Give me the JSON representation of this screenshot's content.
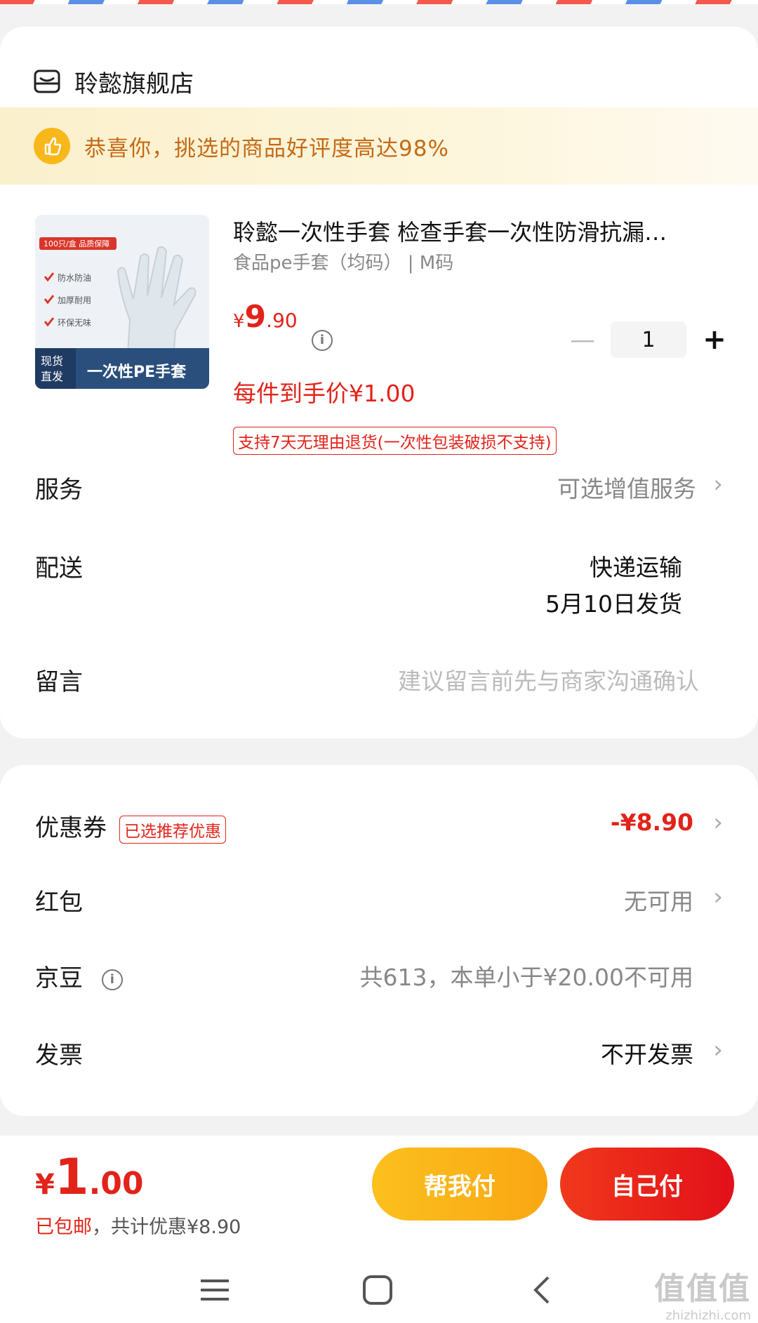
{
  "shop": {
    "name": "聆懿旗舰店"
  },
  "banner": {
    "text": "恭喜你，挑选的商品好评度高达98%"
  },
  "product": {
    "image_overlay": {
      "top_tag": "100只/盒 品质保障",
      "features": [
        "防水防油",
        "加厚耐用",
        "环保无味"
      ],
      "stock_tag_1": "现货",
      "stock_tag_2": "直发",
      "product_tag": "一次性PE手套"
    },
    "title": "聆懿一次性手套 检查手套一次性防滑抗漏…",
    "spec": "食品pe手套（均码） | M码",
    "price_currency": "¥",
    "price_int": "9",
    "price_dec": ".90",
    "quantity": "1",
    "unit_price_label": "每件到手价¥1.00",
    "return_policy": "支持7天无理由退货(一次性包装破损不支持)"
  },
  "rows": {
    "service": {
      "label": "服务",
      "value": "可选增值服务"
    },
    "delivery": {
      "label": "配送",
      "value_line1": "快递运输",
      "value_line2": "5月10日发货"
    },
    "message": {
      "label": "留言",
      "placeholder": "建议留言前先与商家沟通确认"
    }
  },
  "discounts": {
    "coupon": {
      "label": "优惠券",
      "tag": "已选推荐优惠",
      "value": "-¥8.90"
    },
    "red_packet": {
      "label": "红包",
      "value": "无可用"
    },
    "jd_beans": {
      "label": "京豆",
      "value": "共613，本单小于¥20.00不可用"
    },
    "invoice": {
      "label": "发票",
      "value": "不开发票"
    }
  },
  "footer": {
    "total_currency": "¥",
    "total_int": "1",
    "total_dec": ".00",
    "free_shipping": "已包邮",
    "saving": "，共计优惠¥8.90",
    "help_pay": "帮我付",
    "self_pay": "自己付"
  },
  "watermark": {
    "big": "值值值",
    "small": "zhizhizhi.com"
  },
  "colors": {
    "accent_red": "#e2231a",
    "banner_text": "#c46a16",
    "help_pay": "#fbc01e"
  }
}
